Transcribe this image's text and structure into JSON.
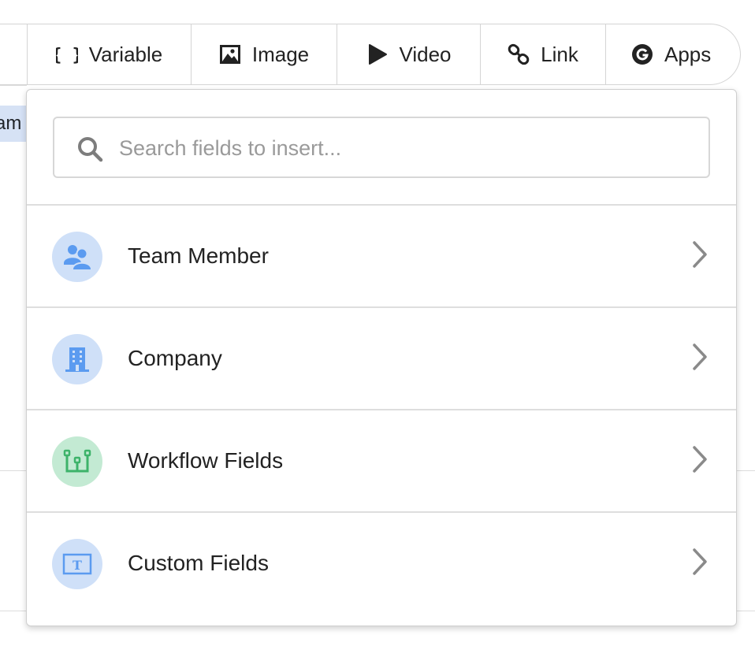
{
  "editor": {
    "selected_text_fragment": "am"
  },
  "toolbar": {
    "buttons": [
      {
        "label": "Variable",
        "icon": "braces-icon"
      },
      {
        "label": "Image",
        "icon": "image-icon"
      },
      {
        "label": "Video",
        "icon": "play-icon"
      },
      {
        "label": "Link",
        "icon": "link-icon"
      },
      {
        "label": "Apps",
        "icon": "apps-g-icon"
      }
    ]
  },
  "dropdown": {
    "search": {
      "placeholder": "Search fields to insert...",
      "value": ""
    },
    "items": [
      {
        "label": "Team Member",
        "icon": "team-member-icon",
        "icon_color": "#5b9bf0",
        "bg_color": "#cfe0f8"
      },
      {
        "label": "Company",
        "icon": "building-icon",
        "icon_color": "#5b9bf0",
        "bg_color": "#cfe0f8"
      },
      {
        "label": "Workflow Fields",
        "icon": "workflow-icon",
        "icon_color": "#3db36a",
        "bg_color": "#c3ead3"
      },
      {
        "label": "Custom Fields",
        "icon": "text-field-icon",
        "icon_color": "#5b9bf0",
        "bg_color": "#cfe0f8"
      }
    ]
  }
}
